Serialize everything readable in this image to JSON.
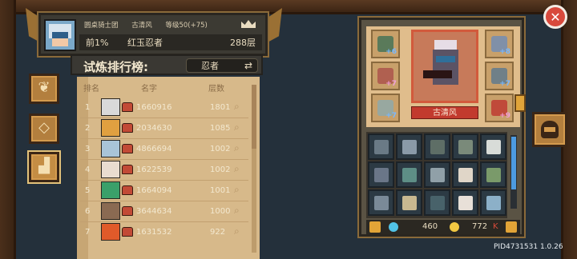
{
  "header": {
    "guild": "圆桌骑士团",
    "player_name": "古清风",
    "level": "等级50(+75)",
    "rank_percent": "前1%",
    "rank_title": "红玉忍者",
    "floor": "288层"
  },
  "leaderboard": {
    "title": "试炼排行榜:",
    "selected_class": "忍者",
    "columns": [
      "排名",
      "名字",
      "层数"
    ],
    "rows": [
      {
        "rank": "1",
        "id": "1660916",
        "floor": "1801",
        "avatar_color": "#d9d9d9"
      },
      {
        "rank": "2",
        "id": "2034630",
        "floor": "1085",
        "avatar_color": "#e0a040"
      },
      {
        "rank": "3",
        "id": "4866694",
        "floor": "1002",
        "avatar_color": "#a9c4d8"
      },
      {
        "rank": "4",
        "id": "1622539",
        "floor": "1002",
        "avatar_color": "#e9dcd0"
      },
      {
        "rank": "5",
        "id": "1664094",
        "floor": "1001",
        "avatar_color": "#3aa06a"
      },
      {
        "rank": "6",
        "id": "3644634",
        "floor": "1000",
        "avatar_color": "#8a6a52"
      },
      {
        "rank": "7",
        "id": "1631532",
        "floor": "922",
        "avatar_color": "#e05a2a"
      }
    ]
  },
  "equipment": {
    "hero_name": "古清风",
    "slots": [
      {
        "name": "helmet-slot",
        "plus": "+6",
        "color": "blue",
        "item_color": "#5a7a5a"
      },
      {
        "name": "armor-slot",
        "plus": "+8",
        "color": "blue",
        "item_color": "#8090a8"
      },
      {
        "name": "ring-slot",
        "plus": "+7",
        "color": "pink",
        "item_color": "#b06050"
      },
      {
        "name": "gloves-slot",
        "plus": "+7",
        "color": "blue",
        "item_color": "#708088"
      },
      {
        "name": "boots-slot",
        "plus": "+7",
        "color": "blue",
        "item_color": "#98a8a0"
      },
      {
        "name": "weapon-slot",
        "plus": "+9",
        "color": "pink",
        "item_color": "#c04a3a"
      }
    ]
  },
  "inventory": {
    "items": [
      "#6a7a86",
      "#8a9aa8",
      "#5e6e66",
      "#7a8a7a",
      "#d8dcd8",
      "#6a7688",
      "#5e8e86",
      "#90a0a8",
      "#e0d6c8",
      "#7a9a6a",
      "#7a8a98",
      "#c8b890",
      "#48626a",
      "#e8e0d8",
      "#8cb0c8"
    ],
    "gems": "460",
    "coins": "772",
    "coin_suffix": "K"
  },
  "footer": {
    "pid": "PID4731531 1.0.26"
  }
}
